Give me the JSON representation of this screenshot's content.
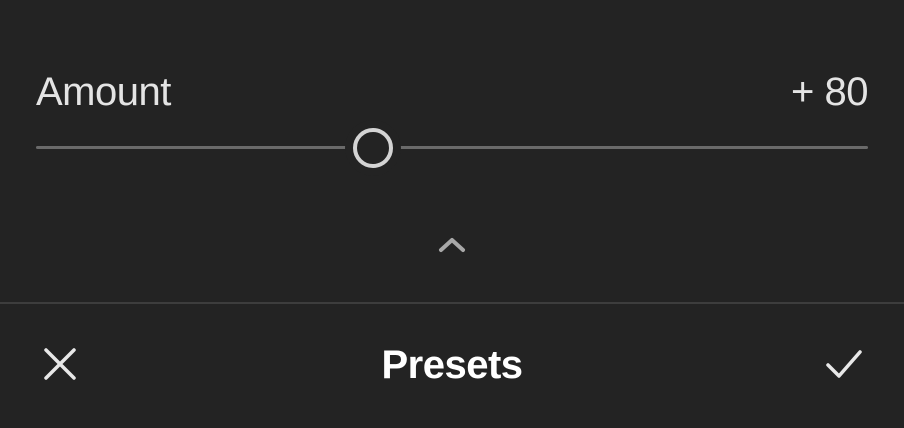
{
  "adjustment": {
    "label": "Amount",
    "value_text": "+ 80",
    "value": 80,
    "min": -100,
    "max": 100,
    "default": 0
  },
  "toolbar": {
    "title": "Presets",
    "cancel_icon": "close-icon",
    "confirm_icon": "checkmark-icon",
    "collapse_icon": "chevron-up-icon"
  },
  "colors": {
    "background": "#232323",
    "text": "#e4e4e4",
    "track": "#6a6a6a",
    "track_fill": "#cfcfcf",
    "thumb": "#d4d4d4"
  }
}
